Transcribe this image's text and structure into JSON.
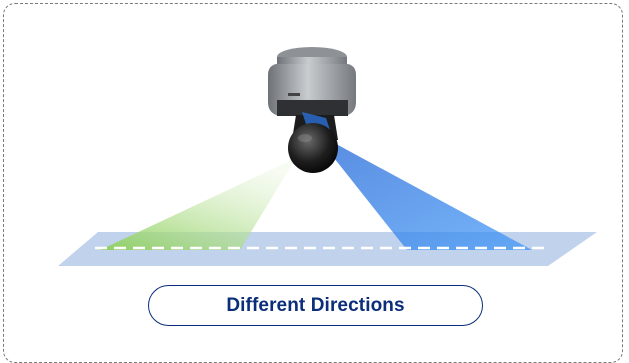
{
  "caption": {
    "label": "Different Directions"
  },
  "colors": {
    "border": "#7a7a7a",
    "caption_text": "#0b2e7a",
    "floor": "#b9cdea",
    "green_beam": "#9fd07a",
    "blue_beam": "#3b8cf0"
  }
}
